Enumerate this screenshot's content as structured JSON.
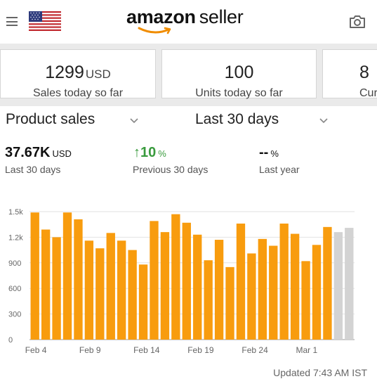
{
  "header": {
    "brand_bold": "amazon",
    "brand_rest": "seller",
    "menu_icon": "hamburger-menu-icon",
    "flag_icon": "us-flag-icon",
    "camera_icon": "camera-icon",
    "accent_color": "#f08c00"
  },
  "cards": [
    {
      "value": "1299",
      "unit": "USD",
      "label": "Sales today so far"
    },
    {
      "value": "100",
      "unit": "",
      "label": "Units today so far"
    },
    {
      "value": "8",
      "unit": "",
      "label": "Cur"
    }
  ],
  "selectors": {
    "metric": "Product sales",
    "range": "Last 30 days"
  },
  "stats": {
    "current_value": "37.67K",
    "current_unit": "USD",
    "current_label": "Last 30 days",
    "change_arrow": "↑",
    "change_value": "10",
    "change_unit": "%",
    "change_label": "Previous 30 days",
    "change_color": "#3a9b3e",
    "lastyear_value": "--",
    "lastyear_unit": "%",
    "lastyear_label": "Last year"
  },
  "chart_data": {
    "type": "bar",
    "ylim": [
      0,
      1500
    ],
    "yticks": [
      0,
      300,
      600,
      900,
      "1.2k",
      "1.5k"
    ],
    "ytick_values": [
      0,
      300,
      600,
      900,
      1200,
      1500
    ],
    "xticks": [
      "Feb 4",
      "Feb 9",
      "Feb 14",
      "Feb 19",
      "Feb 24",
      "Mar 1"
    ],
    "values": [
      1490,
      1290,
      1200,
      1490,
      1410,
      1160,
      1070,
      1250,
      1160,
      1050,
      880,
      1390,
      1260,
      1470,
      1370,
      1230,
      930,
      1170,
      850,
      1360,
      1010,
      1180,
      1100,
      1360,
      1240,
      920,
      1110,
      1320,
      1260,
      1310
    ],
    "projected_from_index": 28,
    "bar_color": "#f89c0e",
    "projected_color": "#d3d3d3",
    "grid": true
  },
  "footer": {
    "updated": "Updated 7:43 AM IST"
  }
}
